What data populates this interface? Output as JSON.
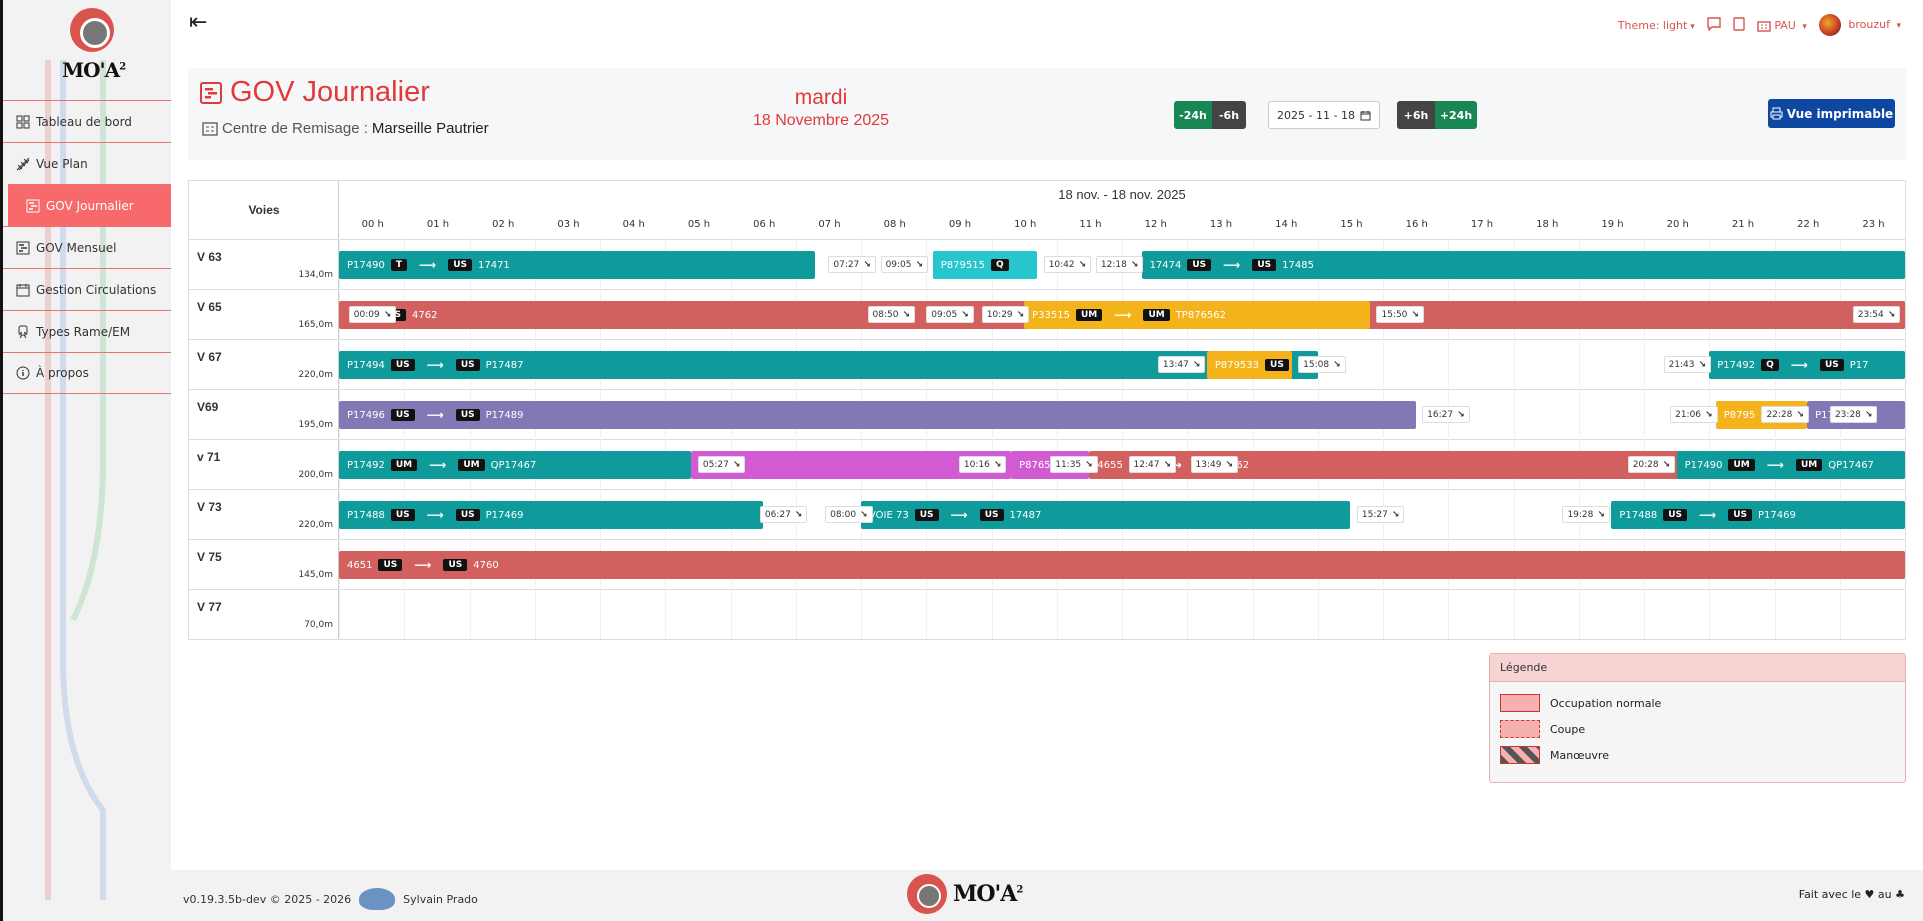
{
  "app": {
    "logo_text": "MO'A",
    "logo_sup": "2"
  },
  "sidebar": {
    "items": [
      {
        "label": "Tableau de bord",
        "icon": "dashboard-icon"
      },
      {
        "label": "Vue Plan",
        "icon": "rail-icon"
      },
      {
        "label": "GOV Journalier",
        "icon": "chart-gantt-icon",
        "active": true
      },
      {
        "label": "GOV Mensuel",
        "icon": "chart-gantt-icon"
      },
      {
        "label": "Gestion Circulations",
        "icon": "calendar-icon"
      },
      {
        "label": "Types Rame/EM",
        "icon": "train-icon"
      },
      {
        "label": "À propos",
        "icon": "info-icon"
      }
    ]
  },
  "topbar": {
    "theme_label": "Theme: light",
    "site_label": "PAU",
    "user_label": "brouzuf"
  },
  "header": {
    "title": "GOV Journalier",
    "subtitle_prefix": "Centre de Remisage :",
    "subtitle_value": "Marseille Pautrier",
    "day": "mardi",
    "date_long": "18 Novembre 2025",
    "btn_minus24": "-24h",
    "btn_minus6": "-6h",
    "date_value": "2025 - 11 - 18",
    "btn_plus6": "+6h",
    "btn_plus24": "+24h",
    "print_label": "Vue imprimable"
  },
  "gantt": {
    "voies_label": "Voies",
    "date_range": "18 nov. - 18 nov. 2025",
    "hours": [
      "00 h",
      "01 h",
      "02 h",
      "03 h",
      "04 h",
      "05 h",
      "06 h",
      "07 h",
      "08 h",
      "09 h",
      "10 h",
      "11 h",
      "12 h",
      "13 h",
      "14 h",
      "15 h",
      "16 h",
      "17 h",
      "18 h",
      "19 h",
      "20 h",
      "21 h",
      "22 h",
      "23 h"
    ],
    "tracks": [
      {
        "name": "V 63",
        "length": "134,0m"
      },
      {
        "name": "V 65",
        "length": "165,0m"
      },
      {
        "name": "V 67",
        "length": "220,0m"
      },
      {
        "name": "V69",
        "length": "195,0m"
      },
      {
        "name": "v 71",
        "length": "200,0m"
      },
      {
        "name": "V 73",
        "length": "220,0m"
      },
      {
        "name": "V 75",
        "length": "145,0m"
      },
      {
        "name": "V 77",
        "length": "70,0m"
      }
    ],
    "bars": [
      {
        "row": 0,
        "start": 0.0,
        "end": 7.3,
        "color": "teal",
        "from": "P17490",
        "tag1": "T",
        "tag2": "US",
        "to": "17471"
      },
      {
        "row": 0,
        "start": 9.1,
        "end": 10.7,
        "color": "cyan",
        "from": "P879515",
        "tag1": "Q",
        "tag2": "",
        "to": ""
      },
      {
        "row": 0,
        "start": 12.3,
        "end": 24.0,
        "color": "teal",
        "from": "17474",
        "tag1": "US",
        "tag2": "US",
        "to": "17485"
      },
      {
        "row": 1,
        "start": 0.0,
        "end": 24.0,
        "color": "red",
        "from": "",
        "tag1": "",
        "tag2": "US",
        "to": "4762"
      },
      {
        "row": 1,
        "start": 10.5,
        "end": 15.8,
        "color": "orange",
        "from": "P33515",
        "tag1": "UM",
        "tag2": "UM",
        "to": "TP876562"
      },
      {
        "row": 2,
        "start": 0.0,
        "end": 15.0,
        "color": "teal",
        "from": "P17494",
        "tag1": "US",
        "tag2": "US",
        "to": "P17487"
      },
      {
        "row": 2,
        "start": 13.3,
        "end": 14.6,
        "color": "orange",
        "from": "P879533",
        "tag1": "US",
        "tag2": "",
        "to": ""
      },
      {
        "row": 2,
        "start": 21.0,
        "end": 24.0,
        "color": "teal",
        "from": "P17492",
        "tag1": "Q",
        "tag2": "US",
        "to": "P17"
      },
      {
        "row": 3,
        "start": 0.0,
        "end": 16.5,
        "color": "purple",
        "from": "P17496",
        "tag1": "US",
        "tag2": "US",
        "to": "P17489"
      },
      {
        "row": 3,
        "start": 21.1,
        "end": 22.5,
        "color": "orange",
        "from": "P8795",
        "tag1": "",
        "tag2": "",
        "to": ""
      },
      {
        "row": 3,
        "start": 22.5,
        "end": 24.0,
        "color": "purple",
        "from": "P1749",
        "tag1": "",
        "tag2": "",
        "to": ""
      },
      {
        "row": 4,
        "start": 0.0,
        "end": 5.4,
        "color": "teal",
        "from": "P17492",
        "tag1": "UM",
        "tag2": "UM",
        "to": "QP17467"
      },
      {
        "row": 4,
        "start": 5.4,
        "end": 10.3,
        "color": "pink",
        "from": "",
        "tag1": "",
        "tag2": "",
        "to": ""
      },
      {
        "row": 4,
        "start": 10.3,
        "end": 11.5,
        "color": "pink",
        "from": "P8765",
        "tag1": "",
        "tag2": "",
        "to": ""
      },
      {
        "row": 4,
        "start": 11.5,
        "end": 24.0,
        "color": "red",
        "from": "4655",
        "tag1": "US",
        "tag2": "US",
        "to": "4762"
      },
      {
        "row": 4,
        "start": 20.5,
        "end": 24.0,
        "color": "teal",
        "from": "P17490",
        "tag1": "UM",
        "tag2": "UM",
        "to": "QP17467"
      },
      {
        "row": 5,
        "start": 0.0,
        "end": 6.5,
        "color": "teal",
        "from": "P17488",
        "tag1": "US",
        "tag2": "US",
        "to": "P17469"
      },
      {
        "row": 5,
        "start": 8.0,
        "end": 15.5,
        "color": "teal",
        "from": "VOIE 73",
        "tag1": "US",
        "tag2": "US",
        "to": "17487"
      },
      {
        "row": 5,
        "start": 19.5,
        "end": 24.0,
        "color": "teal",
        "from": "P17488",
        "tag1": "US",
        "tag2": "US",
        "to": "P17469"
      },
      {
        "row": 6,
        "start": 0.0,
        "end": 24.0,
        "color": "red",
        "from": "4651",
        "tag1": "US",
        "tag2": "US",
        "to": "4760"
      }
    ],
    "time_labels": [
      {
        "row": 0,
        "at": 7.5,
        "text": "07:27",
        "arrow": true
      },
      {
        "row": 0,
        "at": 8.3,
        "text": "09:05",
        "arrow": true
      },
      {
        "row": 0,
        "at": 10.8,
        "text": "10:42",
        "arrow": true
      },
      {
        "row": 0,
        "at": 11.6,
        "text": "12:18",
        "arrow": true
      },
      {
        "row": 1,
        "at": 0.15,
        "text": "00:09",
        "arrow": true
      },
      {
        "row": 1,
        "at": 8.1,
        "text": "08:50",
        "arrow": true
      },
      {
        "row": 1,
        "at": 9.0,
        "text": "09:05",
        "arrow": true
      },
      {
        "row": 1,
        "at": 9.85,
        "text": "10:29",
        "arrow": true
      },
      {
        "row": 1,
        "at": 15.9,
        "text": "15:50",
        "arrow": true
      },
      {
        "row": 1,
        "at": 23.2,
        "text": "23:54",
        "arrow": true
      },
      {
        "row": 2,
        "at": 12.55,
        "text": "13:47",
        "arrow": true
      },
      {
        "row": 2,
        "at": 14.7,
        "text": "15:08",
        "arrow": true
      },
      {
        "row": 2,
        "at": 20.3,
        "text": "21:43",
        "arrow": true
      },
      {
        "row": 3,
        "at": 16.6,
        "text": "16:27",
        "arrow": true
      },
      {
        "row": 3,
        "at": 20.4,
        "text": "21:06",
        "arrow": true
      },
      {
        "row": 3,
        "at": 21.8,
        "text": "22:28",
        "arrow": true
      },
      {
        "row": 3,
        "at": 22.85,
        "text": "23:28",
        "arrow": true
      },
      {
        "row": 4,
        "at": 5.5,
        "text": "05:27",
        "arrow": true
      },
      {
        "row": 4,
        "at": 9.5,
        "text": "10:16",
        "arrow": true
      },
      {
        "row": 4,
        "at": 10.9,
        "text": "11:35",
        "arrow": true
      },
      {
        "row": 4,
        "at": 12.1,
        "text": "12:47",
        "arrow": true
      },
      {
        "row": 4,
        "at": 13.05,
        "text": "13:49",
        "arrow": true
      },
      {
        "row": 4,
        "at": 19.75,
        "text": "20:28",
        "arrow": true
      },
      {
        "row": 5,
        "at": 6.45,
        "text": "06:27",
        "arrow": true
      },
      {
        "row": 5,
        "at": 7.45,
        "text": "08:00",
        "arrow": true
      },
      {
        "row": 5,
        "at": 15.6,
        "text": "15:27",
        "arrow": true
      },
      {
        "row": 5,
        "at": 18.75,
        "text": "19:28",
        "arrow": true
      }
    ]
  },
  "legend": {
    "title": "Légende",
    "items": [
      {
        "label": "Occupation normale",
        "style": "normal"
      },
      {
        "label": "Coupe",
        "style": "dashed"
      },
      {
        "label": "Manœuvre",
        "style": "hatched"
      }
    ]
  },
  "footer": {
    "version": "v0.19.3.5b-dev © 2025 - 2026",
    "author": "Sylvain Prado",
    "made_with": "Fait avec le ♥ au ♣"
  },
  "colors": {
    "accent": "#e23a3a",
    "teal": "#0f9b9b",
    "red": "#d1605f",
    "orange": "#f5b31b",
    "purple": "#8477b5",
    "pink": "#d25ad3",
    "cyan": "#27c5cc",
    "print_button": "#0d47a1"
  }
}
